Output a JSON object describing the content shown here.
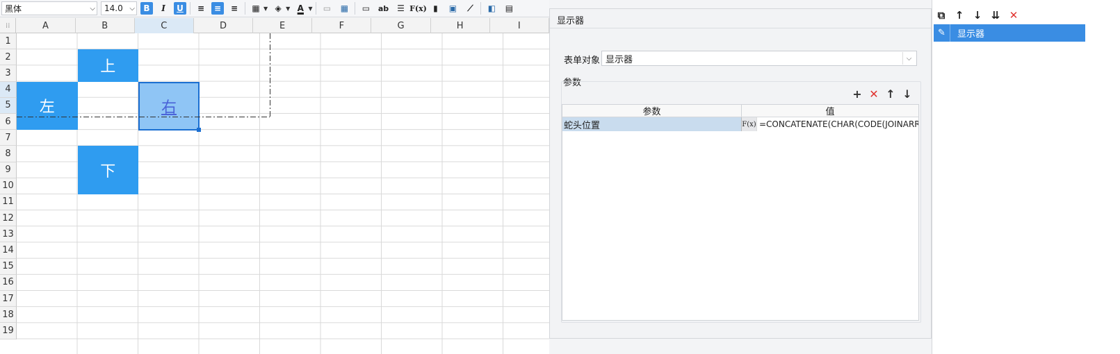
{
  "toolbar": {
    "font_name": "黑体",
    "font_size": "14.0",
    "bold_label": "B",
    "italic_label": "I",
    "underline_label": "U",
    "text_label": "ab",
    "fx_label": "F(x)",
    "fontcolor_label": "A"
  },
  "sheet": {
    "columns": [
      "A",
      "B",
      "C",
      "D",
      "E",
      "F",
      "G",
      "H",
      "I"
    ],
    "rows": [
      "1",
      "2",
      "3",
      "4",
      "5",
      "6",
      "7",
      "8",
      "9",
      "10",
      "11",
      "12",
      "13",
      "14",
      "15",
      "16",
      "17",
      "18",
      "19"
    ],
    "selected_column": "C",
    "cells": {
      "up": "上",
      "left": "左",
      "right": "右",
      "down": "下"
    },
    "accent": "#2f9cf0"
  },
  "panel": {
    "title": "显示器",
    "form_label": "表单对象",
    "form_value": "显示器",
    "params_label": "参数",
    "table_header_param": "参数",
    "table_header_value": "值",
    "rows": [
      {
        "name": "蛇头位置",
        "fx": "F(x)",
        "value": "=CONCATENATE(CHAR(CODE(JOINARRA"
      }
    ]
  },
  "right_panel": {
    "item_label": "显示器",
    "selected_color": "#3a8de3"
  }
}
